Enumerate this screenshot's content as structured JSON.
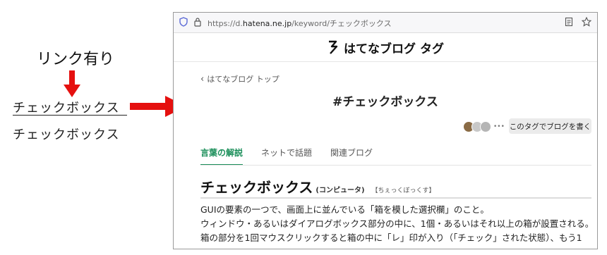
{
  "annotation": {
    "title": "リンク有り",
    "linked_item": "チェックボックス",
    "plain_item": "チェックボックス",
    "arrow_color": "#e5100f"
  },
  "browser": {
    "url_prefix": "https://d.",
    "url_host": "hatena.ne.jp",
    "url_path": "/keyword/チェックボックス",
    "icons": [
      "shield-icon",
      "lock-icon",
      "reader-icon",
      "star-icon"
    ]
  },
  "site": {
    "logo_text": "はてなブログ タグ"
  },
  "page": {
    "back_link": "はてなブログ トップ",
    "tag_title": "#チェックボックス",
    "more": "•••",
    "write_button": "このタグでブログを書く",
    "tabs": [
      "言葉の解説",
      "ネットで話題",
      "関連ブログ"
    ],
    "accent_color": "#1b8f5a",
    "word": "チェックボックス",
    "word_category": "(コンピュータ)",
    "word_reading": "【ちぇっくぼっくす】",
    "body_lines": [
      "GUIの要素の一つで、画面上に並んでいる「箱を模した選択欄」のこと。",
      "ウィンドウ・あるいはダイアログボックス部分の中に、1個・あるいはそれ以上の箱が設置される。",
      "箱の部分を1回マウスクリックすると箱の中に「レ」印が入り（「チェック」された状態）、もう1"
    ]
  }
}
